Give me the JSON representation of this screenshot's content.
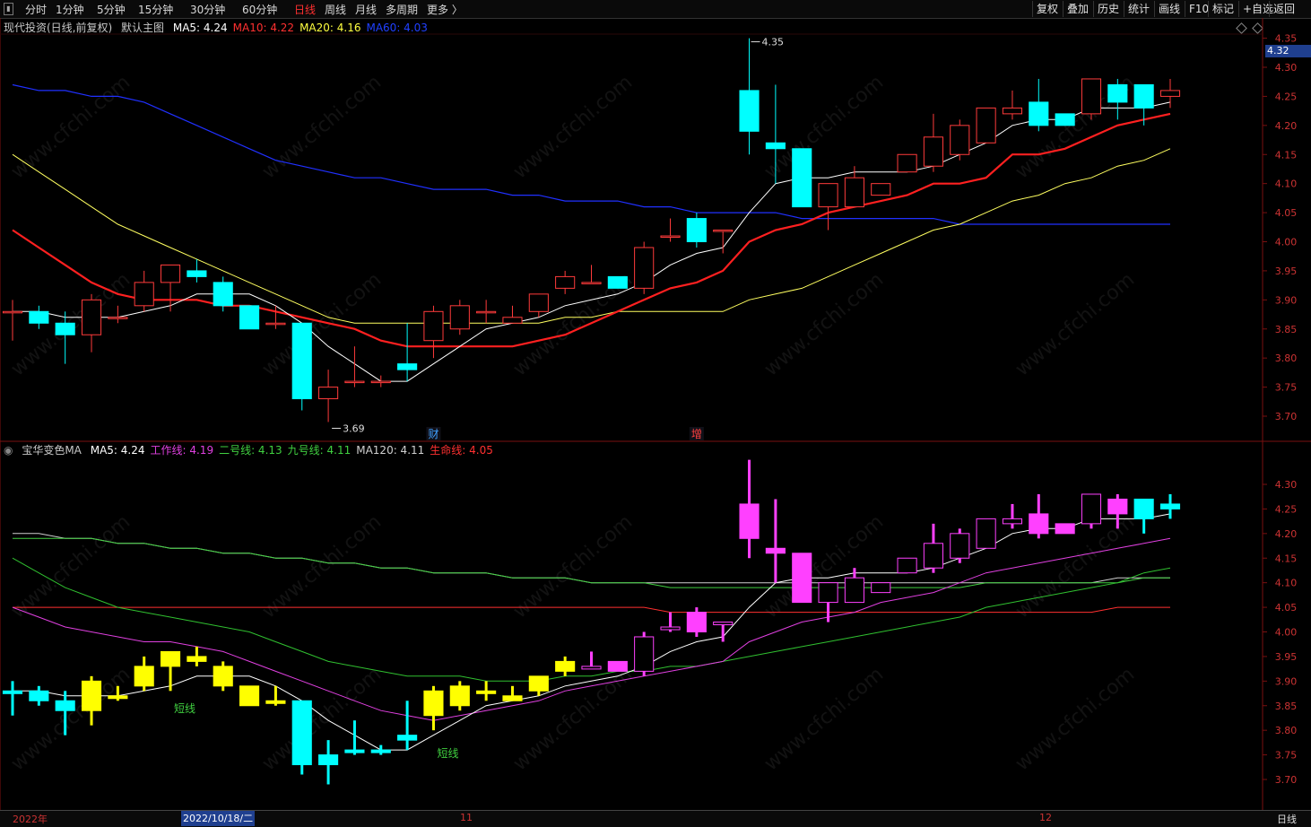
{
  "toolbar": {
    "menu_icon": "menu-icon",
    "periods": [
      "分时",
      "1分钟",
      "5分钟",
      "15分钟",
      "30分钟",
      "60分钟",
      "日线",
      "周线",
      "月线",
      "多周期",
      "更多 〉"
    ],
    "active_period": "日线",
    "right_buttons": [
      "复权",
      "叠加",
      "历史",
      "统计",
      "画线",
      "F10",
      "标记",
      "+自选",
      "返回"
    ]
  },
  "main_panel": {
    "stock_label": "现代投资(日线,前复权)",
    "template": "默认主图",
    "ma": [
      {
        "label": "MA5:",
        "value": "4.24",
        "color": "#ffffff"
      },
      {
        "label": "MA10:",
        "value": "4.22",
        "color": "#ff3030"
      },
      {
        "label": "MA20:",
        "value": "4.16",
        "color": "#ffff40"
      },
      {
        "label": "MA60:",
        "value": "4.03",
        "color": "#2040ff"
      }
    ],
    "price_ticks": [
      "4.35",
      "4.30",
      "4.25",
      "4.20",
      "4.15",
      "4.10",
      "4.05",
      "4.00",
      "3.95",
      "3.90",
      "3.85",
      "3.80",
      "3.75",
      "3.70"
    ],
    "current_price": "4.32",
    "high_marker": "4.35",
    "low_marker": "3.69",
    "event_labels": [
      {
        "text": "财",
        "color": "#40a0ff"
      },
      {
        "text": "增",
        "color": "#ff4040"
      }
    ]
  },
  "sub_panel": {
    "indicator_name": "宝华变色MA",
    "lines": [
      {
        "label": "MA5:",
        "value": "4.24",
        "color": "#ffffff"
      },
      {
        "label": "工作线:",
        "value": "4.19",
        "color": "#e040e0"
      },
      {
        "label": "二号线:",
        "value": "4.13",
        "color": "#40d040"
      },
      {
        "label": "九号线:",
        "value": "4.11",
        "color": "#40d040"
      },
      {
        "label": "MA120:",
        "value": "4.11",
        "color": "#d0d0d0"
      },
      {
        "label": "生命线:",
        "value": "4.05",
        "color": "#ff3030"
      }
    ],
    "price_ticks": [
      "4.30",
      "4.25",
      "4.20",
      "4.15",
      "4.10",
      "4.05",
      "4.00",
      "3.95",
      "3.90",
      "3.85",
      "3.80",
      "3.75",
      "3.70"
    ],
    "annotations": [
      "短线",
      "短线"
    ]
  },
  "date_bar": {
    "year_label": "2022年",
    "cursor_date": "2022/10/18/二",
    "month_labels": [
      "11",
      "12"
    ],
    "period_label": "日线"
  },
  "watermark_text": "www.cfchi.com",
  "colors": {
    "up": "#ff3b3b",
    "down": "#00ffff",
    "ma5": "#ffffff",
    "ma10": "#ff2020",
    "ma20": "#ffff60",
    "ma60": "#2030ff",
    "sub_up": "#ff40ff",
    "sub_yellow": "#ffff00"
  },
  "chart_data": {
    "type": "candlestick",
    "candles": [
      {
        "o": 3.88,
        "h": 3.9,
        "l": 3.83,
        "c": 3.88
      },
      {
        "o": 3.88,
        "h": 3.89,
        "l": 3.85,
        "c": 3.86
      },
      {
        "o": 3.86,
        "h": 3.88,
        "l": 3.79,
        "c": 3.84
      },
      {
        "o": 3.84,
        "h": 3.91,
        "l": 3.81,
        "c": 3.9
      },
      {
        "o": 3.87,
        "h": 3.89,
        "l": 3.86,
        "c": 3.87
      },
      {
        "o": 3.89,
        "h": 3.95,
        "l": 3.88,
        "c": 3.93
      },
      {
        "o": 3.93,
        "h": 3.95,
        "l": 3.88,
        "c": 3.96
      },
      {
        "o": 3.95,
        "h": 3.97,
        "l": 3.93,
        "c": 3.94
      },
      {
        "o": 3.93,
        "h": 3.94,
        "l": 3.88,
        "c": 3.89
      },
      {
        "o": 3.89,
        "h": 3.89,
        "l": 3.85,
        "c": 3.85
      },
      {
        "o": 3.86,
        "h": 3.89,
        "l": 3.85,
        "c": 3.86
      },
      {
        "o": 3.86,
        "h": 3.86,
        "l": 3.71,
        "c": 3.73
      },
      {
        "o": 3.73,
        "h": 3.78,
        "l": 3.69,
        "c": 3.75
      },
      {
        "o": 3.76,
        "h": 3.82,
        "l": 3.75,
        "c": 3.76
      },
      {
        "o": 3.76,
        "h": 3.77,
        "l": 3.75,
        "c": 3.76
      },
      {
        "o": 3.79,
        "h": 3.86,
        "l": 3.76,
        "c": 3.78
      },
      {
        "o": 3.83,
        "h": 3.89,
        "l": 3.8,
        "c": 3.88
      },
      {
        "o": 3.85,
        "h": 3.9,
        "l": 3.84,
        "c": 3.89
      },
      {
        "o": 3.88,
        "h": 3.9,
        "l": 3.86,
        "c": 3.88
      },
      {
        "o": 3.86,
        "h": 3.89,
        "l": 3.86,
        "c": 3.87
      },
      {
        "o": 3.88,
        "h": 3.91,
        "l": 3.87,
        "c": 3.91
      },
      {
        "o": 3.92,
        "h": 3.95,
        "l": 3.91,
        "c": 3.94
      },
      {
        "o": 3.93,
        "h": 3.96,
        "l": 3.93,
        "c": 3.93
      },
      {
        "o": 3.94,
        "h": 3.94,
        "l": 3.92,
        "c": 3.92
      },
      {
        "o": 3.92,
        "h": 4.0,
        "l": 3.91,
        "c": 3.99
      },
      {
        "o": 4.01,
        "h": 4.04,
        "l": 4.0,
        "c": 4.01
      },
      {
        "o": 4.04,
        "h": 4.05,
        "l": 3.99,
        "c": 4.0
      },
      {
        "o": 4.02,
        "h": 4.02,
        "l": 3.98,
        "c": 4.02
      },
      {
        "o": 4.26,
        "h": 4.35,
        "l": 4.15,
        "c": 4.19
      },
      {
        "o": 4.17,
        "h": 4.27,
        "l": 4.1,
        "c": 4.16
      },
      {
        "o": 4.16,
        "h": 4.16,
        "l": 4.06,
        "c": 4.06
      },
      {
        "o": 4.06,
        "h": 4.1,
        "l": 4.02,
        "c": 4.1
      },
      {
        "o": 4.06,
        "h": 4.13,
        "l": 4.06,
        "c": 4.11
      },
      {
        "o": 4.08,
        "h": 4.1,
        "l": 4.08,
        "c": 4.1
      },
      {
        "o": 4.12,
        "h": 4.15,
        "l": 4.12,
        "c": 4.15
      },
      {
        "o": 4.13,
        "h": 4.22,
        "l": 4.12,
        "c": 4.18
      },
      {
        "o": 4.15,
        "h": 4.21,
        "l": 4.14,
        "c": 4.2
      },
      {
        "o": 4.17,
        "h": 4.23,
        "l": 4.17,
        "c": 4.23
      },
      {
        "o": 4.22,
        "h": 4.26,
        "l": 4.21,
        "c": 4.23
      },
      {
        "o": 4.24,
        "h": 4.28,
        "l": 4.19,
        "c": 4.2
      },
      {
        "o": 4.22,
        "h": 4.22,
        "l": 4.2,
        "c": 4.2
      },
      {
        "o": 4.22,
        "h": 4.28,
        "l": 4.21,
        "c": 4.28
      },
      {
        "o": 4.27,
        "h": 4.28,
        "l": 4.21,
        "c": 4.24
      },
      {
        "o": 4.27,
        "h": 4.27,
        "l": 4.2,
        "c": 4.23
      },
      {
        "o": 4.25,
        "h": 4.28,
        "l": 4.23,
        "c": 4.26
      }
    ],
    "ma5": [
      3.88,
      3.88,
      3.87,
      3.87,
      3.87,
      3.88,
      3.89,
      3.91,
      3.91,
      3.91,
      3.89,
      3.86,
      3.82,
      3.79,
      3.76,
      3.76,
      3.79,
      3.82,
      3.85,
      3.86,
      3.87,
      3.89,
      3.9,
      3.91,
      3.93,
      3.96,
      3.98,
      3.99,
      4.05,
      4.1,
      4.11,
      4.11,
      4.12,
      4.12,
      4.12,
      4.13,
      4.15,
      4.17,
      4.2,
      4.21,
      4.21,
      4.23,
      4.23,
      4.23,
      4.24
    ],
    "ma10": [
      4.02,
      3.99,
      3.96,
      3.93,
      3.91,
      3.9,
      3.9,
      3.9,
      3.89,
      3.89,
      3.88,
      3.87,
      3.86,
      3.85,
      3.83,
      3.82,
      3.82,
      3.82,
      3.82,
      3.82,
      3.83,
      3.84,
      3.86,
      3.88,
      3.9,
      3.92,
      3.93,
      3.95,
      4.0,
      4.02,
      4.03,
      4.05,
      4.06,
      4.07,
      4.08,
      4.1,
      4.1,
      4.11,
      4.15,
      4.15,
      4.16,
      4.18,
      4.2,
      4.21,
      4.22
    ],
    "ma20": [
      4.15,
      4.12,
      4.09,
      4.06,
      4.03,
      4.01,
      3.99,
      3.97,
      3.95,
      3.93,
      3.91,
      3.89,
      3.87,
      3.86,
      3.86,
      3.86,
      3.86,
      3.86,
      3.86,
      3.86,
      3.86,
      3.87,
      3.87,
      3.88,
      3.88,
      3.88,
      3.88,
      3.88,
      3.9,
      3.91,
      3.92,
      3.94,
      3.96,
      3.98,
      4.0,
      4.02,
      4.03,
      4.05,
      4.07,
      4.08,
      4.1,
      4.11,
      4.13,
      4.14,
      4.16
    ],
    "ma60": [
      4.27,
      4.26,
      4.26,
      4.25,
      4.25,
      4.24,
      4.22,
      4.2,
      4.18,
      4.16,
      4.14,
      4.13,
      4.12,
      4.11,
      4.11,
      4.1,
      4.09,
      4.09,
      4.09,
      4.08,
      4.08,
      4.07,
      4.07,
      4.07,
      4.06,
      4.06,
      4.05,
      4.05,
      4.05,
      4.05,
      4.04,
      4.04,
      4.04,
      4.04,
      4.04,
      4.04,
      4.03,
      4.03,
      4.03,
      4.03,
      4.03,
      4.03,
      4.03,
      4.03,
      4.03
    ],
    "sub_work": [
      4.05,
      4.03,
      4.01,
      4.0,
      3.99,
      3.98,
      3.98,
      3.97,
      3.96,
      3.94,
      3.92,
      3.9,
      3.88,
      3.86,
      3.84,
      3.83,
      3.82,
      3.83,
      3.84,
      3.85,
      3.86,
      3.88,
      3.89,
      3.9,
      3.91,
      3.92,
      3.93,
      3.94,
      3.98,
      4.0,
      4.02,
      4.03,
      4.04,
      4.06,
      4.07,
      4.08,
      4.1,
      4.12,
      4.13,
      4.14,
      4.15,
      4.16,
      4.17,
      4.18,
      4.19
    ],
    "sub_two": [
      4.15,
      4.12,
      4.09,
      4.07,
      4.05,
      4.04,
      4.03,
      4.02,
      4.01,
      4.0,
      3.98,
      3.96,
      3.94,
      3.93,
      3.92,
      3.91,
      3.91,
      3.91,
      3.9,
      3.9,
      3.9,
      3.91,
      3.91,
      3.92,
      3.92,
      3.93,
      3.93,
      3.94,
      3.95,
      3.96,
      3.97,
      3.98,
      3.99,
      4.0,
      4.01,
      4.02,
      4.03,
      4.05,
      4.06,
      4.07,
      4.08,
      4.09,
      4.1,
      4.12,
      4.13
    ],
    "sub_nine": [
      4.19,
      4.19,
      4.19,
      4.19,
      4.18,
      4.18,
      4.17,
      4.17,
      4.16,
      4.16,
      4.15,
      4.15,
      4.14,
      4.14,
      4.13,
      4.13,
      4.12,
      4.12,
      4.12,
      4.11,
      4.11,
      4.11,
      4.1,
      4.1,
      4.1,
      4.09,
      4.09,
      4.09,
      4.09,
      4.09,
      4.09,
      4.09,
      4.09,
      4.09,
      4.09,
      4.09,
      4.09,
      4.1,
      4.1,
      4.1,
      4.1,
      4.1,
      4.1,
      4.11,
      4.11
    ],
    "sub_ma120": [
      4.2,
      4.2,
      4.19,
      4.19,
      4.18,
      4.18,
      4.17,
      4.17,
      4.16,
      4.16,
      4.15,
      4.15,
      4.14,
      4.14,
      4.13,
      4.13,
      4.12,
      4.12,
      4.12,
      4.11,
      4.11,
      4.11,
      4.1,
      4.1,
      4.1,
      4.1,
      4.1,
      4.1,
      4.1,
      4.1,
      4.1,
      4.1,
      4.1,
      4.1,
      4.1,
      4.1,
      4.1,
      4.1,
      4.1,
      4.1,
      4.1,
      4.1,
      4.11,
      4.11,
      4.11
    ],
    "sub_life": [
      4.05,
      4.05,
      4.05,
      4.05,
      4.05,
      4.05,
      4.05,
      4.05,
      4.05,
      4.05,
      4.05,
      4.05,
      4.05,
      4.05,
      4.05,
      4.05,
      4.05,
      4.05,
      4.05,
      4.05,
      4.05,
      4.05,
      4.05,
      4.05,
      4.05,
      4.04,
      4.04,
      4.04,
      4.04,
      4.04,
      4.04,
      4.04,
      4.04,
      4.04,
      4.04,
      4.04,
      4.04,
      4.04,
      4.04,
      4.04,
      4.04,
      4.04,
      4.05,
      4.05,
      4.05
    ]
  }
}
